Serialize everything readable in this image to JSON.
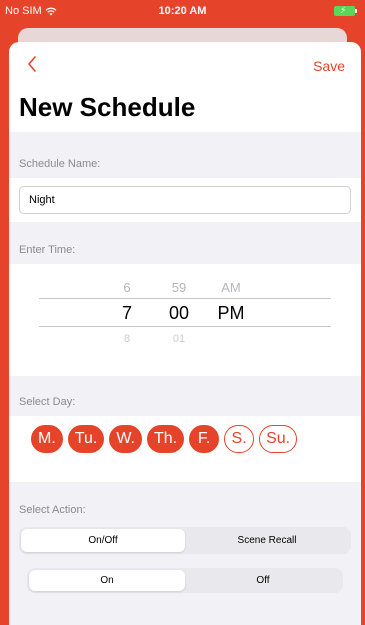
{
  "status": {
    "carrier": "No SIM",
    "time": "10:20 AM"
  },
  "nav": {
    "save_label": "Save"
  },
  "title": "New Schedule",
  "sections": {
    "name": "Schedule Name:",
    "time": "Enter Time:",
    "day": "Select Day:",
    "action": "Select Action:"
  },
  "schedule_name": "Night",
  "time_picker": {
    "hour": {
      "above": "6",
      "selected": "7",
      "below": "8"
    },
    "minute": {
      "above": "59",
      "selected": "00",
      "below": "01"
    },
    "period": {
      "above": "AM",
      "selected": "PM"
    }
  },
  "days": [
    {
      "label": "M.",
      "selected": true
    },
    {
      "label": "Tu.",
      "selected": true
    },
    {
      "label": "W.",
      "selected": true
    },
    {
      "label": "Th.",
      "selected": true
    },
    {
      "label": "F.",
      "selected": true
    },
    {
      "label": "S.",
      "selected": false
    },
    {
      "label": "Su.",
      "selected": false
    }
  ],
  "action_segment": {
    "options": [
      "On/Off",
      "Scene Recall"
    ],
    "selected": "On/Off"
  },
  "power_segment": {
    "options": [
      "On",
      "Off"
    ],
    "selected": "On"
  },
  "colors": {
    "accent": "#e5432a",
    "section_bg": "#f2f2f6"
  },
  "icons": {
    "back": "chevron-left-icon",
    "wifi": "wifi-icon",
    "battery": "battery-charging-icon"
  }
}
